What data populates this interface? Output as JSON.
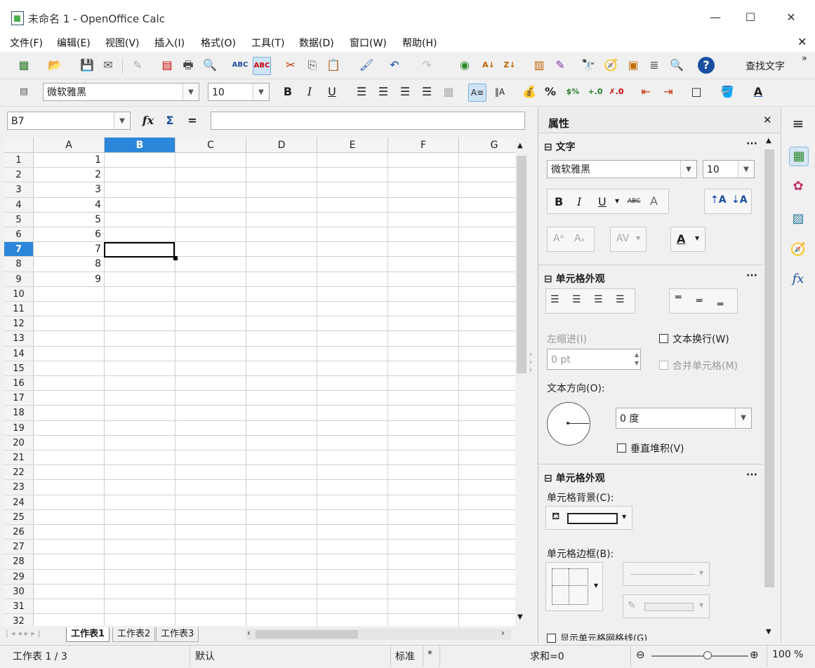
{
  "window": {
    "title": "未命名 1 - OpenOffice Calc",
    "minimize": "—",
    "maximize": "☐",
    "close": "✕"
  },
  "menu": {
    "items": [
      "文件(F)",
      "编辑(E)",
      "视图(V)",
      "插入(I)",
      "格式(O)",
      "工具(T)",
      "数据(D)",
      "窗口(W)",
      "帮助(H)"
    ],
    "doc_close": "✕"
  },
  "toolbar": {
    "find_label": "查找文字"
  },
  "format_toolbar": {
    "font_name": "微软雅黑",
    "font_size": "10",
    "bold": "B",
    "italic": "I",
    "underline": "U",
    "percent": "%"
  },
  "formula_bar": {
    "name_box": "B7",
    "fx": "fx",
    "sum": "Σ",
    "equals": "=",
    "formula": ""
  },
  "grid": {
    "columns": [
      "A",
      "B",
      "C",
      "D",
      "E",
      "F",
      "G"
    ],
    "selected_column": "B",
    "selected_row": "7",
    "rows": [
      "1",
      "2",
      "3",
      "4",
      "5",
      "6",
      "7",
      "8",
      "9",
      "10",
      "11",
      "12",
      "13",
      "14",
      "15",
      "16",
      "17",
      "18",
      "19",
      "20",
      "21",
      "22",
      "23",
      "24",
      "25",
      "26",
      "27",
      "28",
      "29",
      "30",
      "31",
      "32"
    ],
    "column_a_values": [
      "1",
      "2",
      "3",
      "4",
      "5",
      "6",
      "7",
      "8",
      "9"
    ]
  },
  "sheet_tabs": {
    "tabs": [
      "工作表1",
      "工作表2",
      "工作表3"
    ],
    "active": "工作表1"
  },
  "status_bar": {
    "sheet": "工作表 1 / 3",
    "style": "默认",
    "mode": "标准",
    "modified": "*",
    "sum": "求和=0",
    "zoom": "100 %",
    "zoom_level": 0.58
  },
  "sidebar": {
    "title": "属性",
    "close": "✕",
    "text_section": {
      "title": "文字",
      "font_name": "微软雅黑",
      "font_size": "10",
      "bold": "B",
      "italic": "I",
      "underline": "U",
      "strike": "ABC"
    },
    "alignment_section": {
      "title": "单元格外观",
      "indent_label": "左缩进(I)",
      "indent_value": "0 pt",
      "wrap_label": "文本换行(W)",
      "merge_label": "合并单元格(M)",
      "orientation_label": "文本方向(O):",
      "angle_value": "0 度",
      "vertical_stack_label": "垂直堆积(V)"
    },
    "appearance_section": {
      "title": "单元格外观",
      "background_label": "单元格背景(C):",
      "border_label": "单元格边框(B):",
      "gridlines_label": "显示单元格网格线(G)"
    }
  },
  "colors": {
    "accent": "#1c7fd6",
    "selected_header": "#2c86d9",
    "selection_border": "#000000"
  }
}
